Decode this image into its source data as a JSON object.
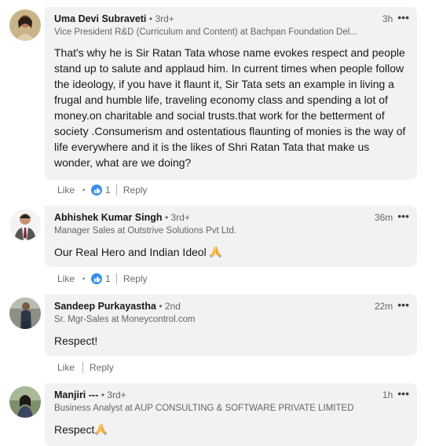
{
  "comments": [
    {
      "name": "Uma Devi Subraveti",
      "degree": "• 3rd+",
      "headline": "Vice President R&D (Curriculum and Content) at Bachpan Foundation Del...",
      "time": "3h",
      "more": "•••",
      "text": "That's  why he is Sir Ratan Tata whose name evokes respect and people stand up to salute and applaud him. In current times when people follow the ideology, if you have it flaunt it, Sir Tata sets an example in living a frugal and humble life, traveling economy class and spending a lot of money.on charitable and social trusts.that work for the betterment of society .Consumerism and ostentatious flaunting of monies is the way of life everywhere and it is the likes of Shri Ratan Tata that make us wonder, what are we doing?",
      "like": "Like",
      "reaction_count": "1",
      "reply": "Reply"
    },
    {
      "name": "Abhishek Kumar Singh",
      "degree": "• 3rd+",
      "headline": "Manager Sales at Outstrive Solutions Pvt Ltd.",
      "time": "36m",
      "more": "•••",
      "text": "Our Real Hero and Indian Ideol",
      "like": "Like",
      "reaction_count": "1",
      "reply": "Reply"
    },
    {
      "name": "Sandeep Purkayastha",
      "degree": "• 2nd",
      "headline": "Sr. Mgr-Sales at Moneycontrol.com",
      "time": "22m",
      "more": "•••",
      "text": "Respect!",
      "like": "Like",
      "reply": "Reply"
    },
    {
      "name": "Manjiri ---",
      "degree": "• 3rd+",
      "headline": "Business Analyst at AUP CONSULTING & SOFTWARE PRIVATE LIMITED",
      "time": "1h",
      "more": "•••",
      "text": "Respect"
    }
  ],
  "icons": {
    "like_reaction": "thumbs-up-icon",
    "pray": "folded-hands-icon",
    "more": "more-options-icon"
  },
  "colors": {
    "bubble": "#f2f2f2",
    "reaction_blue": "#378fe9"
  }
}
